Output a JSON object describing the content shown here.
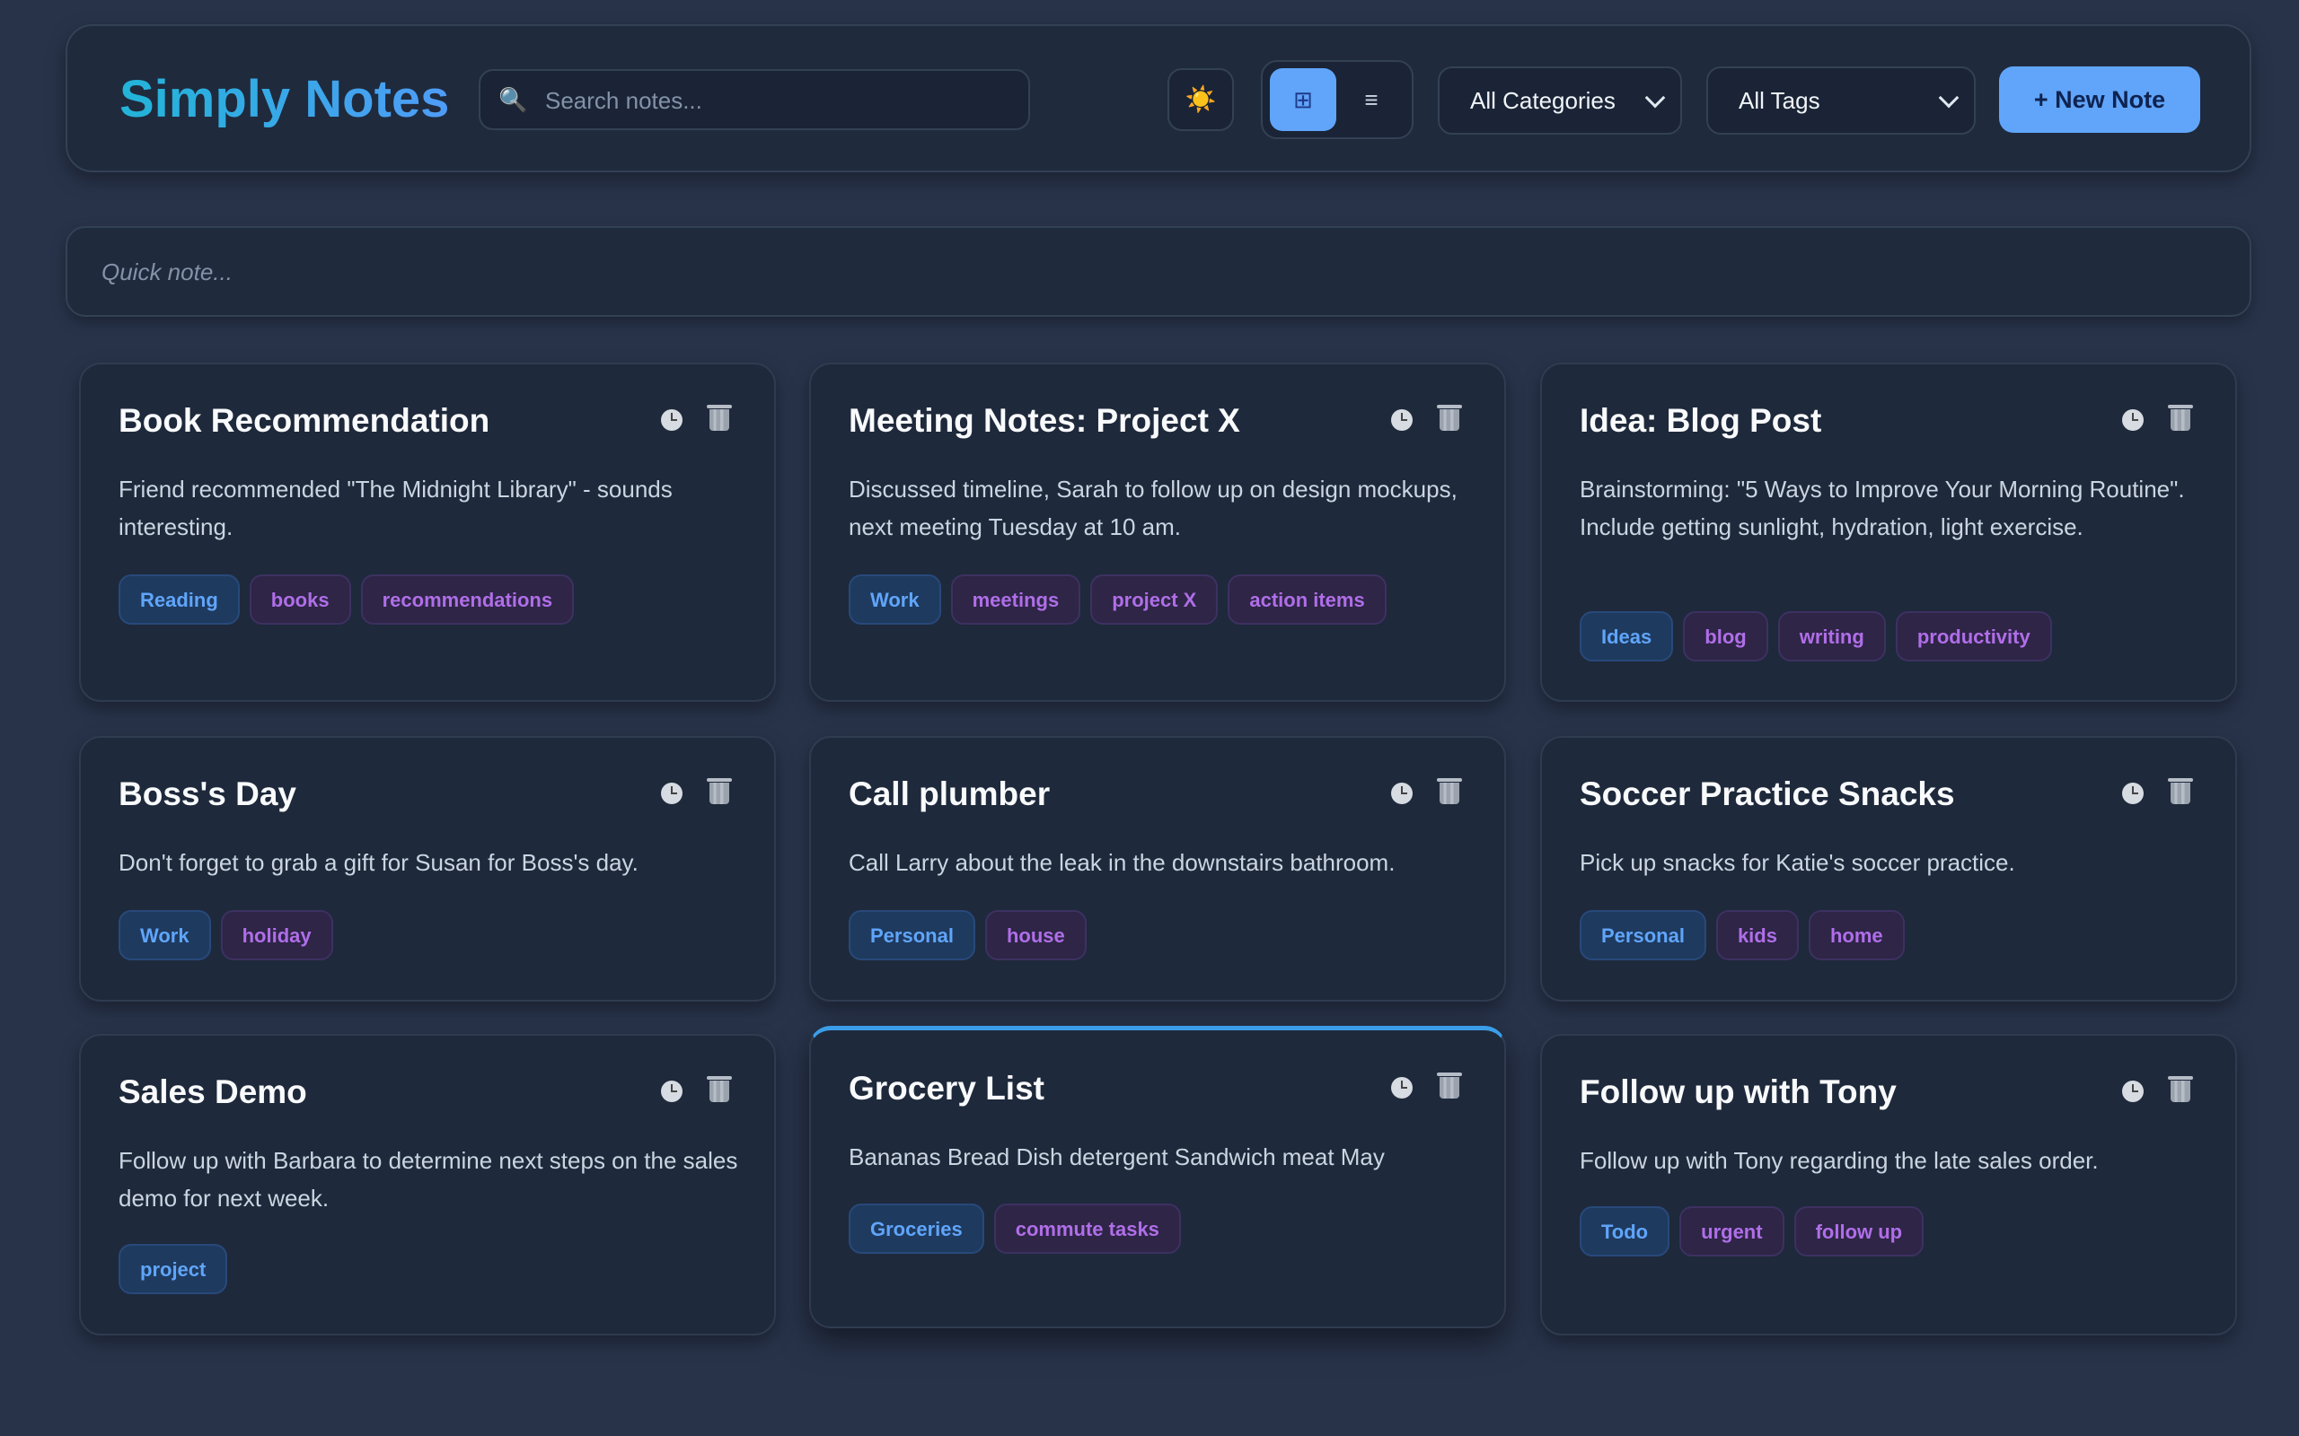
{
  "app": {
    "title": "Simply Notes",
    "search_placeholder": "Search notes...",
    "search_icon": "🔍",
    "theme_icon": "☀️",
    "view_grid_icon": "⊞",
    "view_list_icon": "≡",
    "category_select": "All Categories",
    "tag_select": "All Tags",
    "new_note_label": "+ New Note",
    "quick_note_placeholder": "Quick note..."
  },
  "notes": [
    {
      "title": "Book Recommendation",
      "body": "Friend recommended \"The Midnight Library\" - sounds interesting.",
      "category": "Reading",
      "tags": [
        "books",
        "recommendations"
      ]
    },
    {
      "title": "Meeting Notes: Project X",
      "body": "Discussed timeline, Sarah to follow up on design mockups, next meeting Tuesday at 10 am.",
      "category": "Work",
      "tags": [
        "meetings",
        "project X",
        "action items"
      ]
    },
    {
      "title": "Idea: Blog Post",
      "body": "Brainstorming: \"5 Ways to Improve Your Morning Routine\". Include getting sunlight, hydration, light exercise.",
      "category": "Ideas",
      "tags": [
        "blog",
        "writing",
        "productivity"
      ]
    },
    {
      "title": "Boss's Day",
      "body": "Don't forget to grab a gift for Susan for Boss's day.",
      "category": "Work",
      "tags": [
        "holiday"
      ]
    },
    {
      "title": "Call plumber",
      "body": "Call Larry about the leak in the downstairs bathroom.",
      "category": "Personal",
      "tags": [
        "house"
      ]
    },
    {
      "title": "Soccer Practice Snacks",
      "body": "Pick up snacks for Katie's soccer practice.",
      "category": "Personal",
      "tags": [
        "kids",
        "home"
      ]
    },
    {
      "title": "Sales Demo",
      "body": "Follow up with Barbara to determine next steps on the sales demo for next week.",
      "category": "project",
      "tags": []
    },
    {
      "title": "Grocery List",
      "body": "Bananas Bread Dish detergent Sandwich meat May",
      "category": "Groceries",
      "tags": [
        "commute tasks"
      ]
    },
    {
      "title": "Follow up with Tony",
      "body": "Follow up with Tony regarding the late sales order.",
      "category": "Todo",
      "tags": [
        "urgent",
        "follow up"
      ]
    }
  ],
  "colors": {
    "accent": "#60a5fa",
    "tag_purple": "#b06ee8",
    "card_bg": "#1e293b",
    "page_bg": "#28334a"
  }
}
